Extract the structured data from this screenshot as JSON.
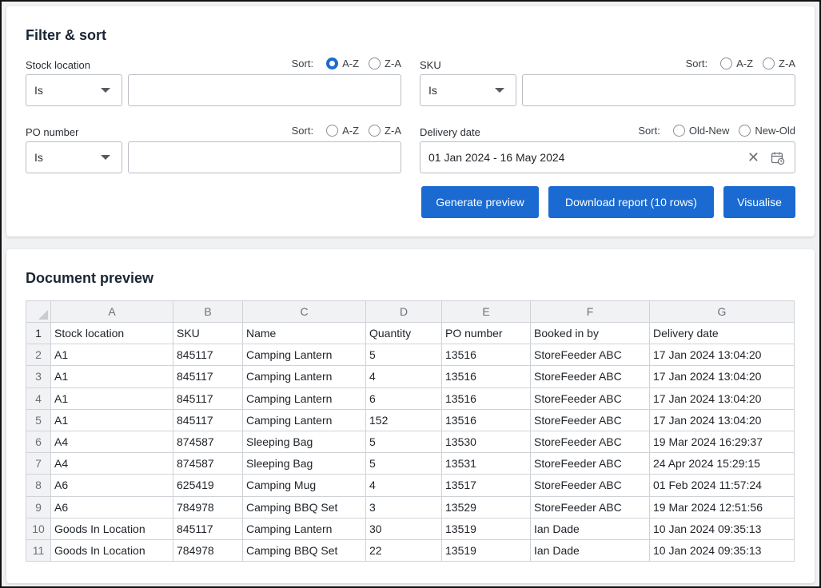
{
  "filter": {
    "title": "Filter & sort",
    "stock_location": {
      "label": "Stock location",
      "sort_label": "Sort:",
      "options": [
        "A-Z",
        "Z-A"
      ],
      "selected_sort": "A-Z",
      "operator": "Is",
      "value": ""
    },
    "sku": {
      "label": "SKU",
      "sort_label": "Sort:",
      "options": [
        "A-Z",
        "Z-A"
      ],
      "selected_sort": "",
      "operator": "Is",
      "value": ""
    },
    "po_number": {
      "label": "PO number",
      "sort_label": "Sort:",
      "options": [
        "A-Z",
        "Z-A"
      ],
      "selected_sort": "",
      "operator": "Is",
      "value": ""
    },
    "delivery_date": {
      "label": "Delivery date",
      "sort_label": "Sort:",
      "options": [
        "Old-New",
        "New-Old"
      ],
      "selected_sort": "",
      "value": "01 Jan 2024 - 16 May 2024"
    },
    "buttons": {
      "generate": "Generate preview",
      "download": "Download report (10 rows)",
      "visualise": "Visualise"
    },
    "accent_color": "#1a6ad1"
  },
  "preview": {
    "title": "Document preview",
    "column_letters": [
      "A",
      "B",
      "C",
      "D",
      "E",
      "F",
      "G"
    ],
    "row_numbers": [
      "1",
      "2",
      "3",
      "4",
      "5",
      "6",
      "7",
      "8",
      "9",
      "10",
      "11"
    ],
    "headers": [
      "Stock location",
      "SKU",
      "Name",
      "Quantity",
      "PO number",
      "Booked in by",
      "Delivery date"
    ],
    "rows": [
      [
        "A1",
        "845117",
        "Camping Lantern",
        "5",
        "13516",
        "StoreFeeder ABC",
        "17 Jan 2024 13:04:20"
      ],
      [
        "A1",
        "845117",
        "Camping Lantern",
        "4",
        "13516",
        "StoreFeeder ABC",
        "17 Jan 2024 13:04:20"
      ],
      [
        "A1",
        "845117",
        "Camping Lantern",
        "6",
        "13516",
        "StoreFeeder ABC",
        "17 Jan 2024 13:04:20"
      ],
      [
        "A1",
        "845117",
        "Camping Lantern",
        "152",
        "13516",
        "StoreFeeder ABC",
        "17 Jan 2024 13:04:20"
      ],
      [
        "A4",
        "874587",
        "Sleeping Bag",
        "5",
        "13530",
        "StoreFeeder ABC",
        "19 Mar 2024 16:29:37"
      ],
      [
        "A4",
        "874587",
        "Sleeping Bag",
        "5",
        "13531",
        "StoreFeeder ABC",
        "24 Apr 2024 15:29:15"
      ],
      [
        "A6",
        "625419",
        "Camping Mug",
        "4",
        "13517",
        "StoreFeeder ABC",
        "01 Feb 2024 11:57:24"
      ],
      [
        "A6",
        "784978",
        "Camping BBQ Set",
        "3",
        "13529",
        "StoreFeeder ABC",
        "19 Mar 2024 12:51:56"
      ],
      [
        "Goods In Location",
        "845117",
        "Camping Lantern",
        "30",
        "13519",
        "Ian Dade",
        "10 Jan 2024 09:35:13"
      ],
      [
        "Goods In Location",
        "784978",
        "Camping BBQ Set",
        "22",
        "13519",
        "Ian Dade",
        "10 Jan 2024 09:35:13"
      ]
    ]
  }
}
